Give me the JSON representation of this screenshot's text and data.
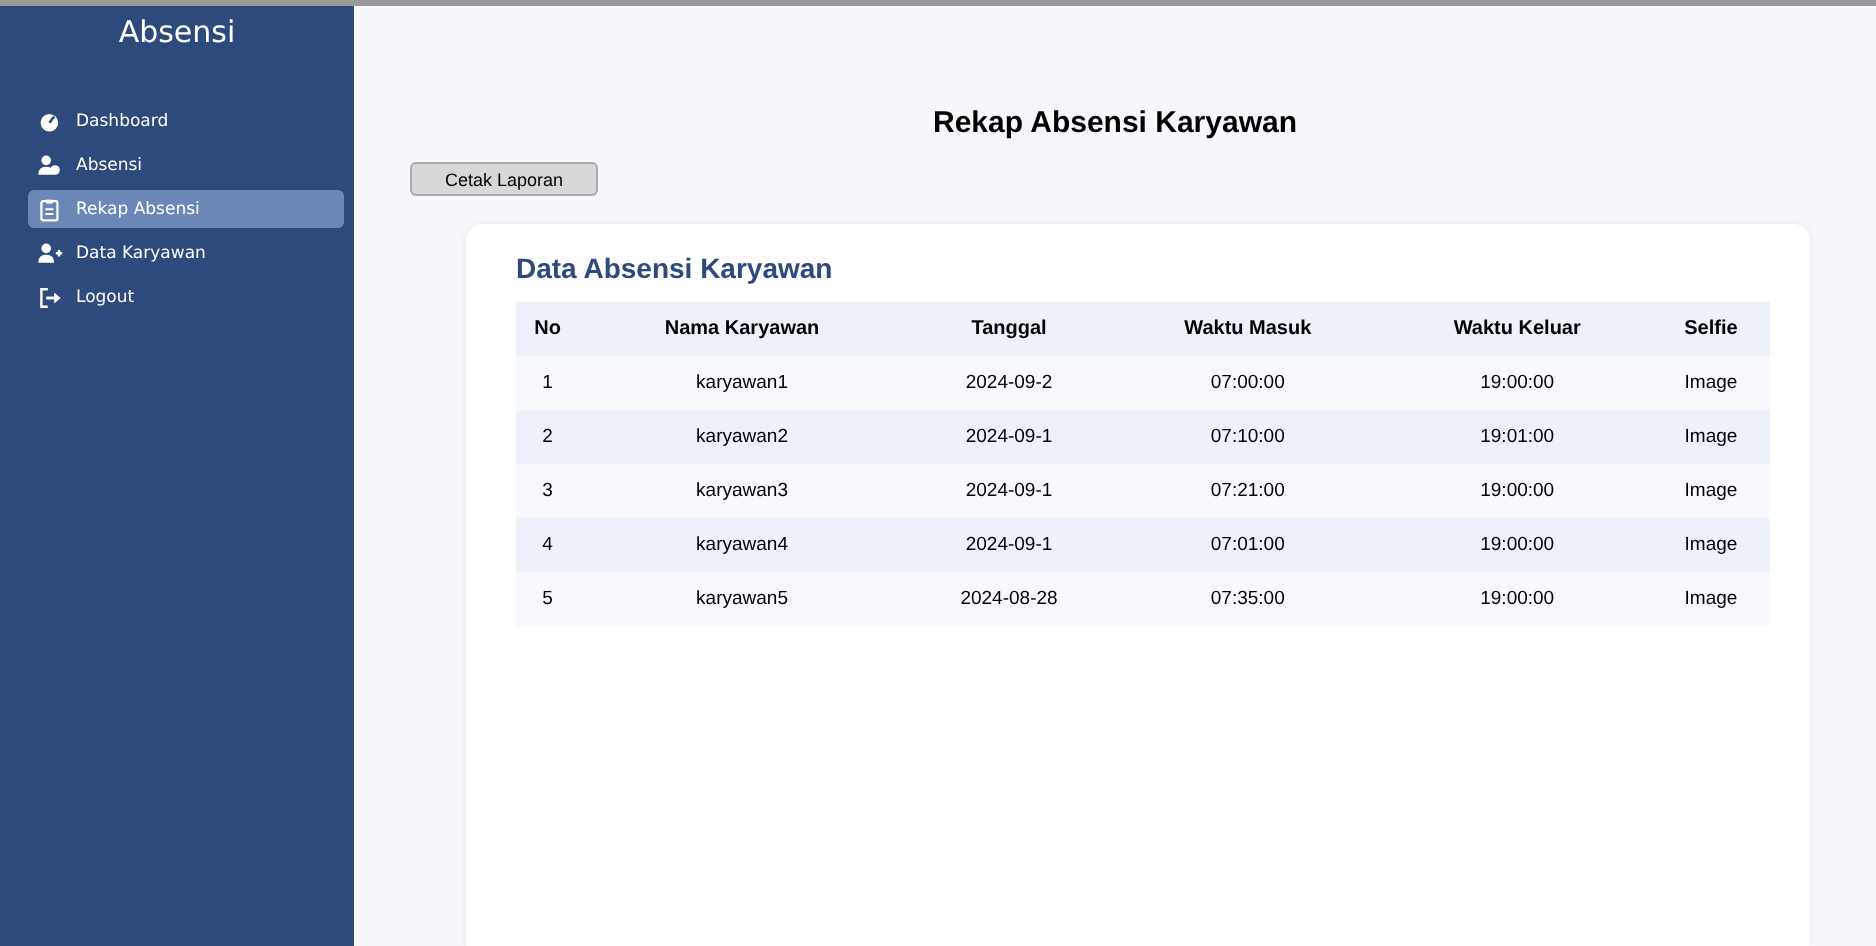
{
  "sidebar": {
    "title": "Absensi",
    "items": [
      {
        "label": "Dashboard",
        "selected": false
      },
      {
        "label": "Absensi",
        "selected": false
      },
      {
        "label": "Rekap Absensi",
        "selected": true
      },
      {
        "label": "Data Karyawan",
        "selected": false
      },
      {
        "label": "Logout",
        "selected": false
      }
    ]
  },
  "page_title": "Rekap Absensi Karyawan",
  "print_button": "Cetak Laporan",
  "card": {
    "title": "Data Absensi Karyawan",
    "table": {
      "columns": [
        "No",
        "Nama Karyawan",
        "Tanggal",
        "Waktu Masuk",
        "Waktu Keluar",
        "Selfie"
      ],
      "rows": [
        [
          "1",
          "karyawan1",
          "2024-09-2",
          "07:00:00",
          "19:00:00",
          "Image"
        ],
        [
          "2",
          "karyawan2",
          "2024-09-1",
          "07:10:00",
          "19:01:00",
          "Image"
        ],
        [
          "3",
          "karyawan3",
          "2024-09-1",
          "07:21:00",
          "19:00:00",
          "Image"
        ],
        [
          "4",
          "karyawan4",
          "2024-09-1",
          "07:01:00",
          "19:00:00",
          "Image"
        ],
        [
          "5",
          "karyawan5",
          "2024-08-28",
          "07:35:00",
          "19:00:00",
          "Image"
        ]
      ]
    }
  }
}
